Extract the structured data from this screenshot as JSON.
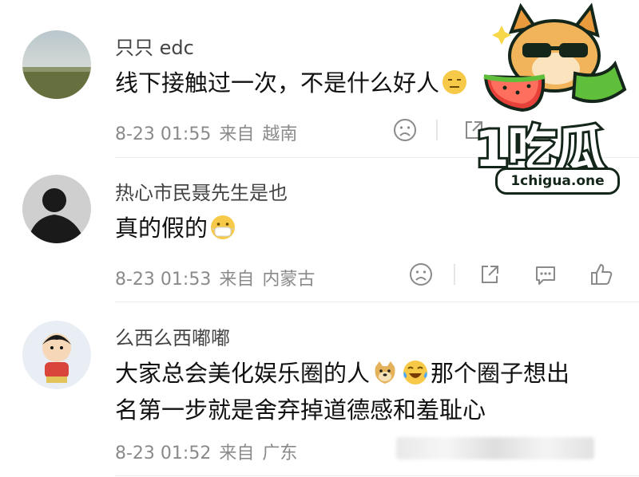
{
  "comments": [
    {
      "username": "只只 edc",
      "text": "线下接触过一次，不是什么好人",
      "time": "8-23 01:55",
      "source_prefix": "来自",
      "location": "越南"
    },
    {
      "username": "热心市民聂先生是也",
      "text": "真的假的",
      "time": "8-23 01:53",
      "source_prefix": "来自",
      "location": "内蒙古"
    },
    {
      "username": "么西么西嘟嘟",
      "text_line1_a": "大家总会美化娱乐圈的人",
      "text_line1_b": "那个圈子想出",
      "text_line2": "名第一步就是舍弃掉道德感和羞耻心",
      "time": "8-23 01:52",
      "source_prefix": "来自",
      "location": "广东"
    }
  ],
  "watermark": {
    "brand": "1吃瓜",
    "url": "1chigua.one"
  },
  "icons": {
    "dislike": "sad-face-icon",
    "share": "share-icon",
    "comment": "comment-icon",
    "like": "thumbs-up-icon"
  },
  "colors": {
    "meta": "#8a8a8a",
    "username": "#444444",
    "text": "#111111",
    "watermark_green": "#5fbf3a"
  }
}
